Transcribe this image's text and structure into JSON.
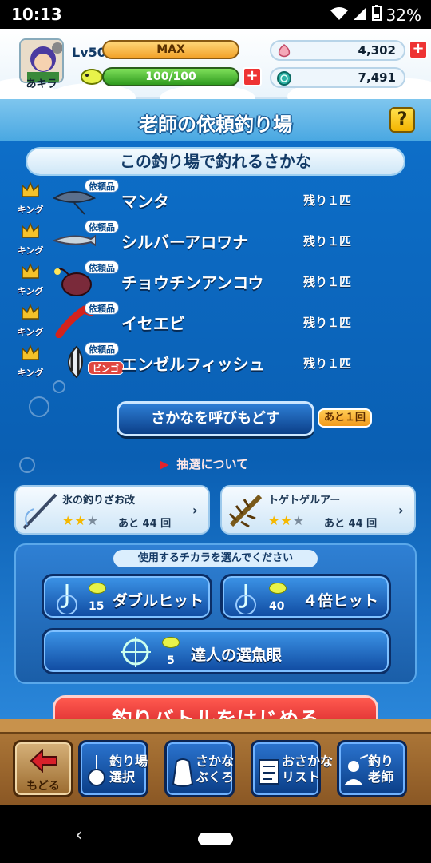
{
  "status_bar": {
    "time": "10:13",
    "battery": "32%"
  },
  "player": {
    "name": "あキラ",
    "level": "Lv50",
    "rank": "MAX",
    "stamina": "100/100",
    "stamina_fraction": 1.0
  },
  "currency": {
    "gems": "4,302",
    "coins": "7,491"
  },
  "title": "老師の依頼釣り場",
  "help_label": "?",
  "fish_section": {
    "header": "この釣り場で釣れるさかな",
    "items": [
      {
        "rank": "キング",
        "tag": "依頼品",
        "name": "マンタ",
        "remaining": "残り１匹",
        "bingo": ""
      },
      {
        "rank": "キング",
        "tag": "依頼品",
        "name": "シルバーアロワナ",
        "remaining": "残り１匹",
        "bingo": ""
      },
      {
        "rank": "キング",
        "tag": "依頼品",
        "name": "チョウチンアンコウ",
        "remaining": "残り１匹",
        "bingo": ""
      },
      {
        "rank": "キング",
        "tag": "依頼品",
        "name": "イセエビ",
        "remaining": "残り１匹",
        "bingo": ""
      },
      {
        "rank": "キング",
        "tag": "依頼品",
        "name": "エンゼルフィッシュ",
        "remaining": "残り１匹",
        "bingo": "ビンゴ"
      }
    ]
  },
  "recall": {
    "label": "さかなを呼びもどす",
    "badge": "あと１回"
  },
  "lottery_link": "抽選について",
  "gear": [
    {
      "name": "氷の釣りざお改",
      "stars": 2,
      "max_stars": 3,
      "remaining": "あと 44 回"
    },
    {
      "name": "トゲトゲルアー",
      "stars": 2,
      "max_stars": 3,
      "remaining": "あと 44 回"
    }
  ],
  "power": {
    "prompt": "使用するチカラを選んでください",
    "options": [
      {
        "label": "ダブルヒット",
        "cost": "15"
      },
      {
        "label": "４倍ヒット",
        "cost": "40"
      },
      {
        "label": "達人の選魚眼",
        "cost": "5"
      }
    ]
  },
  "battle_label": "釣りバトルをはじめる",
  "nav": {
    "back": "もどる",
    "items": [
      {
        "line1": "釣り場",
        "line2": "選択"
      },
      {
        "line1": "さかな",
        "line2": "ぶくろ"
      },
      {
        "line1": "おさかな",
        "line2": "リスト"
      },
      {
        "line1": "釣り",
        "line2": "老師"
      }
    ]
  },
  "colors": {
    "accent": "#0a5fb3",
    "battle": "#e0261f",
    "gold": "#f2a22a"
  }
}
